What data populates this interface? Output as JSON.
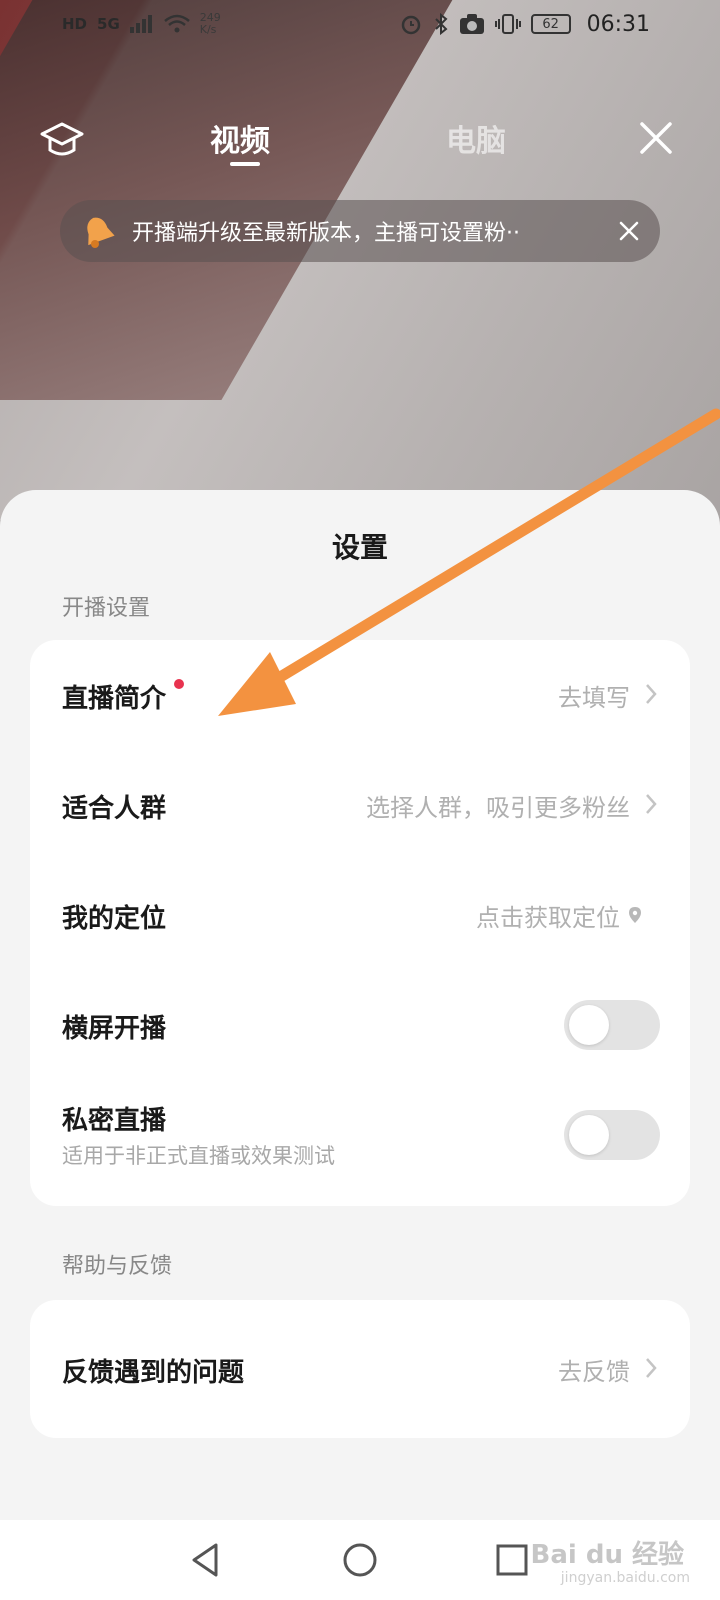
{
  "status_bar": {
    "left_badge": "HD",
    "network": "5G",
    "speed_value": "249",
    "speed_unit": "K/s",
    "battery": "62",
    "time": "06:31"
  },
  "top_nav": {
    "tabs": [
      {
        "label": "视频",
        "active": true
      },
      {
        "label": "电脑",
        "active": false
      }
    ]
  },
  "notice": {
    "text": "开播端升级至最新版本，主播可设置粉··"
  },
  "sheet": {
    "title": "设置",
    "section_live": "开播设置",
    "rows": {
      "intro": {
        "label": "直播简介",
        "value": "去填写"
      },
      "audience": {
        "label": "适合人群",
        "value": "选择人群，吸引更多粉丝"
      },
      "location": {
        "label": "我的定位",
        "value": "点击获取定位"
      },
      "landscape": {
        "label": "横屏开播",
        "toggle": false
      },
      "private": {
        "label": "私密直播",
        "sub": "适用于非正式直播或效果测试",
        "toggle": false
      }
    },
    "section_help": "帮助与反馈",
    "feedback": {
      "label": "反馈遇到的问题",
      "value": "去反馈"
    }
  },
  "watermark": {
    "brand": "Bai du 经验",
    "url": "jingyan.baidu.com"
  },
  "colors": {
    "accent_dot": "#e8334f",
    "arrow": "#f39240",
    "sheet_bg": "#f4f4f4"
  }
}
